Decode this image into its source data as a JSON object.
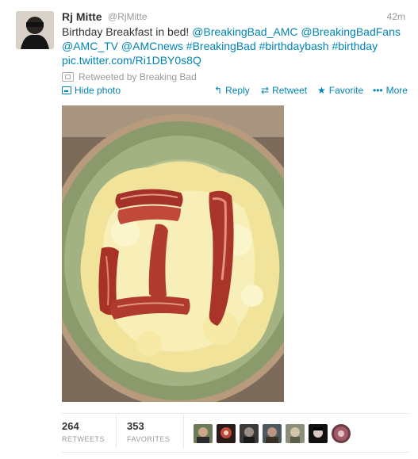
{
  "tweet": {
    "author_name": "Rj Mitte",
    "author_handle": "@RjMitte",
    "time": "42m",
    "text_plain": "Birthday Breakfast in bed!",
    "mentions": [
      "@BreakingBad_AMC",
      "@BreakingBadFans",
      "@AMC_TV",
      "@AMCnews"
    ],
    "hashtags": [
      "#BreakingBad",
      "#birthdaybash",
      "#birthday"
    ],
    "pic_link": "pic.twitter.com/Ri1DBY0s8Q",
    "retweeted_by": "Retweeted by Breaking Bad"
  },
  "actions": {
    "hide_photo": "Hide photo",
    "reply": "Reply",
    "retweet": "Retweet",
    "favorite": "Favorite",
    "more": "More"
  },
  "stats": {
    "retweets_count": "264",
    "retweets_label": "RETWEETS",
    "favorites_count": "353",
    "favorites_label": "FAVORITES"
  },
  "icons": {
    "avatar": "profile-avatar",
    "retweeted_indicator": "retweet-icon",
    "photo": "photo-icon",
    "reply": "reply-icon",
    "retweet": "retweet-icon",
    "favorite": "star-icon",
    "more": "more-dots-icon"
  },
  "colors": {
    "link": "#0084b4",
    "muted": "#999999",
    "text": "#333333"
  }
}
